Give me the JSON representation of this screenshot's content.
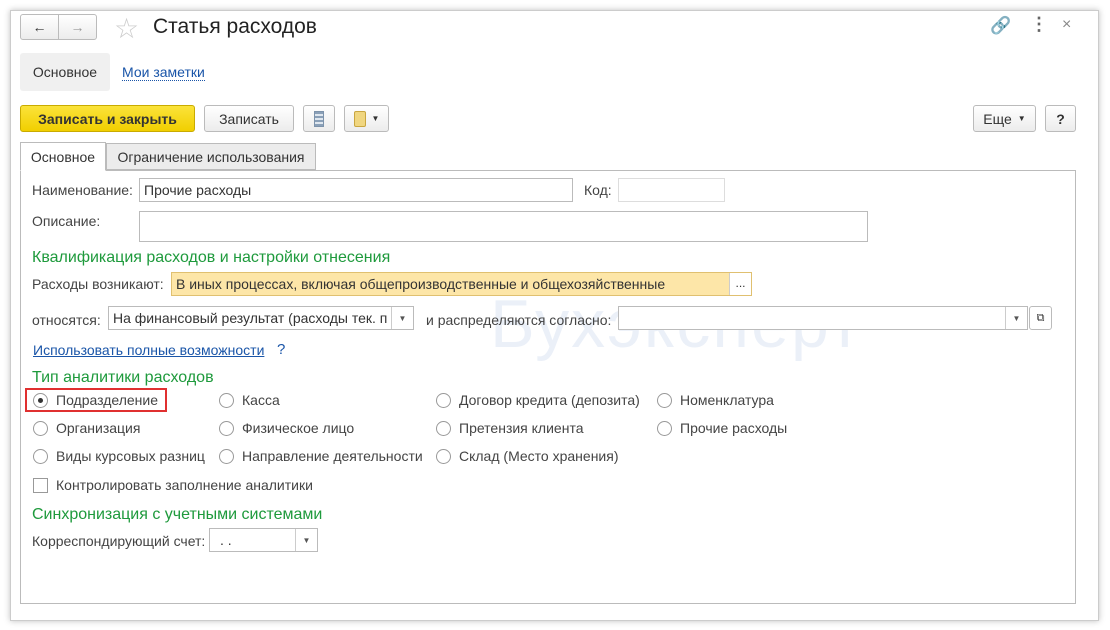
{
  "title": "Статья расходов",
  "nav": {
    "back": "←",
    "forward": "→"
  },
  "top_tabs": [
    {
      "label": "Основное"
    },
    {
      "label": "Мои заметки"
    }
  ],
  "toolbar": {
    "save_close": "Записать и закрыть",
    "save": "Записать",
    "more": "Еще",
    "help": "?"
  },
  "form_tabs": [
    {
      "label": "Основное"
    },
    {
      "label": "Ограничение использования"
    }
  ],
  "fields": {
    "name_label": "Наименование:",
    "name_value": "Прочие расходы",
    "code_label": "Код:",
    "code_value": "",
    "desc_label": "Описание:",
    "desc_value": ""
  },
  "qualification": {
    "title": "Квалификация расходов и настройки отнесения",
    "arise_label": "Расходы возникают:",
    "arise_value": "В иных процессах, включая общепроизводственные и общехозяйственные",
    "ellipsis": "...",
    "relate_label": "относятся:",
    "relate_value": "На финансовый результат (расходы тек. п",
    "distribute_label": "и распределяются согласно:",
    "distribute_value": "",
    "full_link": "Использовать полные возможности",
    "help": "?"
  },
  "analytics": {
    "title": "Тип аналитики расходов",
    "options": [
      {
        "label": "Подразделение",
        "selected": true
      },
      {
        "label": "Касса",
        "selected": false
      },
      {
        "label": "Договор кредита (депозита)",
        "selected": false
      },
      {
        "label": "Номенклатура",
        "selected": false
      },
      {
        "label": "Организация",
        "selected": false
      },
      {
        "label": "Физическое лицо",
        "selected": false
      },
      {
        "label": "Претензия клиента",
        "selected": false
      },
      {
        "label": "Прочие расходы",
        "selected": false
      },
      {
        "label": "Виды курсовых разниц",
        "selected": false
      },
      {
        "label": "Направление деятельности",
        "selected": false
      },
      {
        "label": "Склад (Место хранения)",
        "selected": false
      }
    ],
    "control_label": "Контролировать заполнение аналитики",
    "control_checked": false
  },
  "sync": {
    "title": "Синхронизация с учетными системами",
    "account_label": "Корреспондирующий счет:",
    "account_value": ". ."
  },
  "watermark": "Бухэксперт",
  "colors": {
    "accent_yellow": "#f5d90a",
    "section_green": "#1e9a3c",
    "highlight": "#e03030"
  }
}
